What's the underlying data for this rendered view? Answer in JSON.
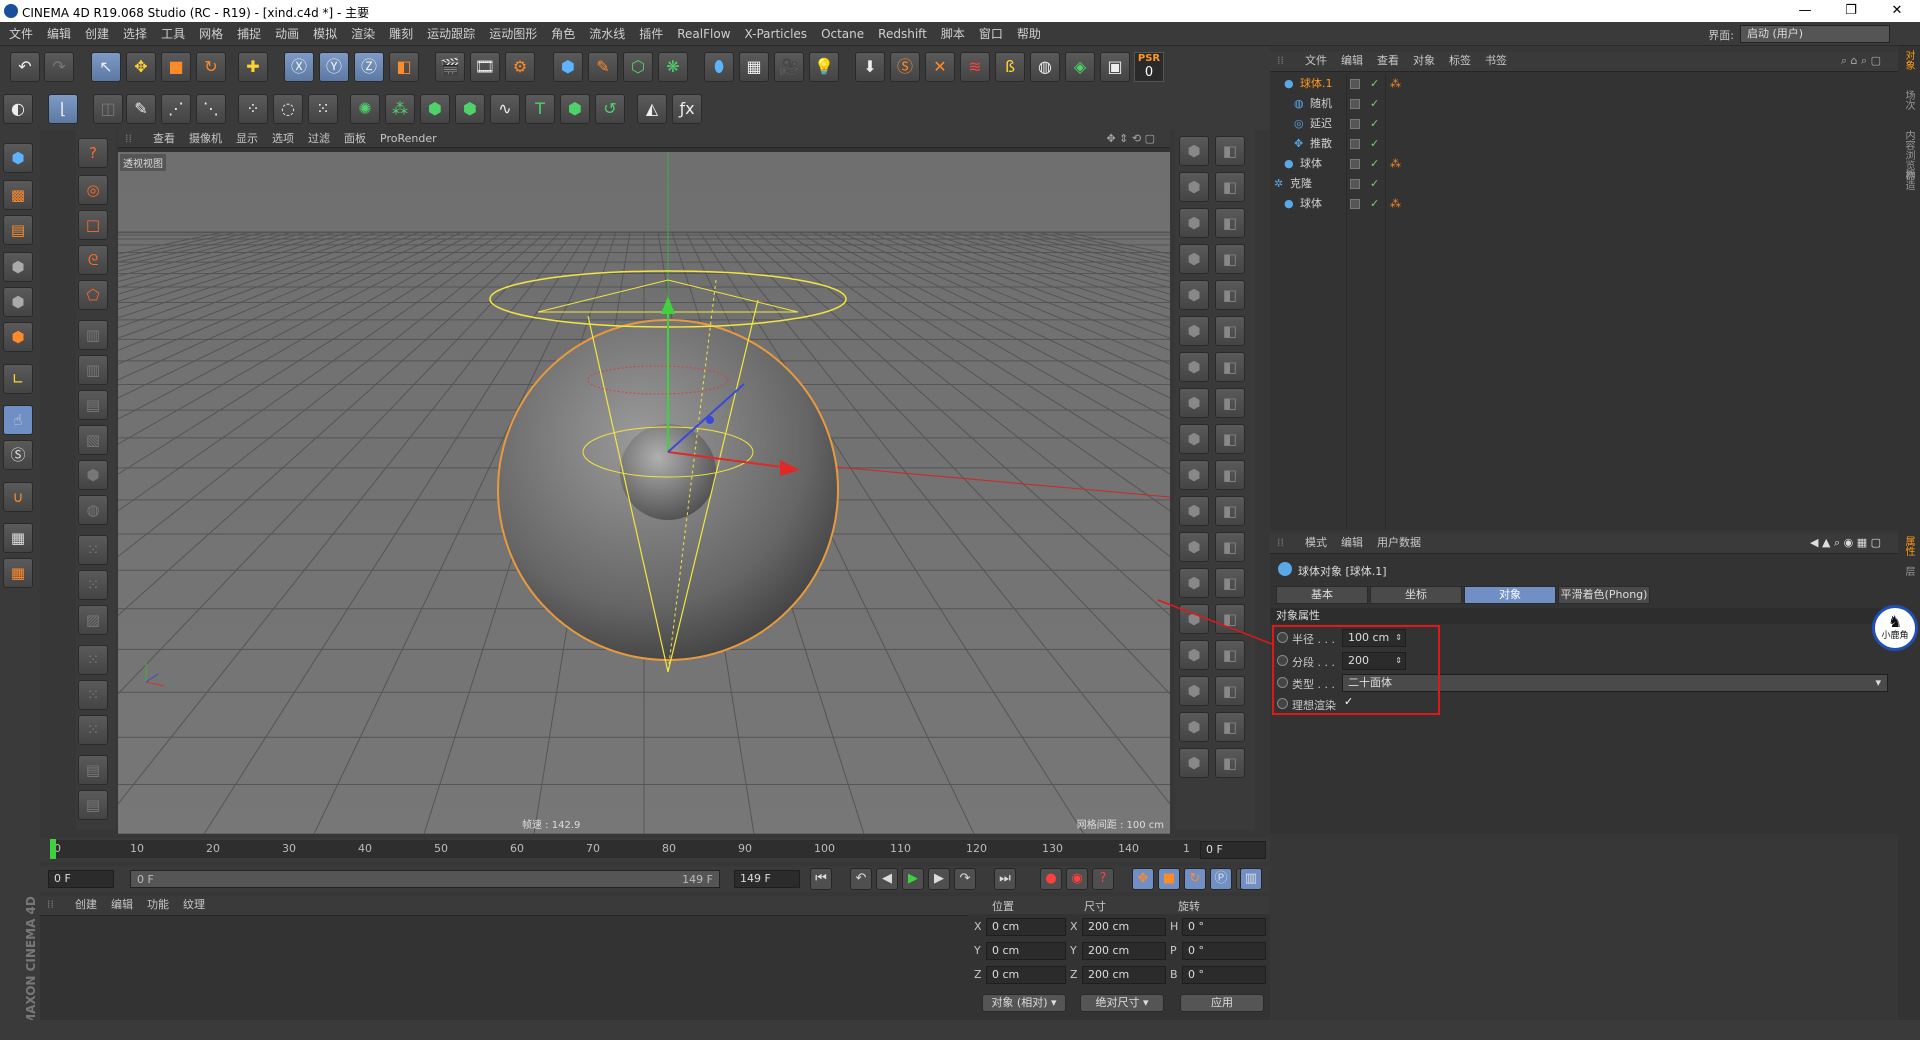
{
  "window": {
    "title": "CINEMA 4D R19.068 Studio (RC - R19) - [xind.c4d *] - 主要",
    "min": "—",
    "max": "❐",
    "close": "✕"
  },
  "menu": [
    "文件",
    "编辑",
    "创建",
    "选择",
    "工具",
    "网格",
    "捕捉",
    "动画",
    "模拟",
    "渲染",
    "雕刻",
    "运动跟踪",
    "运动图形",
    "角色",
    "流水线",
    "插件",
    "RealFlow",
    "X-Particles",
    "Octane",
    "Redshift",
    "脚本",
    "窗口",
    "帮助"
  ],
  "layout": {
    "label": "界面:",
    "value": "启动 (用户)"
  },
  "toolbar": {
    "psr_label": "PSR",
    "psr_value": "0"
  },
  "viewport": {
    "menu": [
      "查看",
      "摄像机",
      "显示",
      "选项",
      "过滤",
      "面板",
      "ProRender"
    ],
    "name": "透视视图",
    "fps": "帧速 : 142.9",
    "grid": "网格间距 : 100 cm"
  },
  "objmgr": {
    "menu": [
      "文件",
      "编辑",
      "查看",
      "对象",
      "标签",
      "书签"
    ],
    "objects": [
      {
        "name": "球体.1",
        "icon": "●",
        "selected": true
      },
      {
        "name": "随机",
        "icon": "◍",
        "selected": false
      },
      {
        "name": "延迟",
        "icon": "◎",
        "selected": false
      },
      {
        "name": "推散",
        "icon": "✥",
        "selected": false
      },
      {
        "name": "球体",
        "icon": "●",
        "selected": false
      },
      {
        "name": "克隆",
        "icon": "✲",
        "selected": false
      },
      {
        "name": "球体",
        "icon": "●",
        "selected": false
      }
    ]
  },
  "attr": {
    "menu": [
      "模式",
      "编辑",
      "用户数据"
    ],
    "title": "球体对象 [球体.1]",
    "tabs": [
      "基本",
      "坐标",
      "对象",
      "平滑着色(Phong)"
    ],
    "section": "对象属性",
    "radius_label": "半径 . . .",
    "radius": "100 cm",
    "segments_label": "分段 . . .",
    "segments": "200",
    "type_label": "类型 . . .",
    "type": "二十面体",
    "render_label": "理想渲染",
    "render_check": "✓"
  },
  "side_tabs": [
    "对象",
    "场次",
    "内容浏览器",
    "构造"
  ],
  "attr_side_tabs": [
    "属性",
    "层"
  ],
  "timeline": {
    "ticks": [
      "0",
      "10",
      "20",
      "30",
      "40",
      "50",
      "60",
      "70",
      "80",
      "90",
      "100",
      "110",
      "120",
      "130",
      "140"
    ],
    "end": "1",
    "frame": "0 F",
    "start": "0 F",
    "slider_start": "0 F",
    "slider_end": "149 F",
    "max": "149 F"
  },
  "material": {
    "menu": [
      "创建",
      "编辑",
      "功能",
      "纹理"
    ],
    "brand": "MAXON CINEMA 4D"
  },
  "coords": {
    "headers": [
      "位置",
      "尺寸",
      "旋转"
    ],
    "rows": [
      {
        "axis": "X",
        "pos": "0 cm",
        "saxis": "X",
        "size": "200 cm",
        "raxis": "H",
        "rot": "0 °"
      },
      {
        "axis": "Y",
        "pos": "0 cm",
        "saxis": "Y",
        "size": "200 cm",
        "raxis": "P",
        "rot": "0 °"
      },
      {
        "axis": "Z",
        "pos": "0 cm",
        "saxis": "Z",
        "size": "200 cm",
        "raxis": "B",
        "rot": "0 °"
      }
    ],
    "mode": "对象 (相对)",
    "size_mode": "绝对尺寸",
    "apply": "应用"
  },
  "badge": "小鹿角"
}
